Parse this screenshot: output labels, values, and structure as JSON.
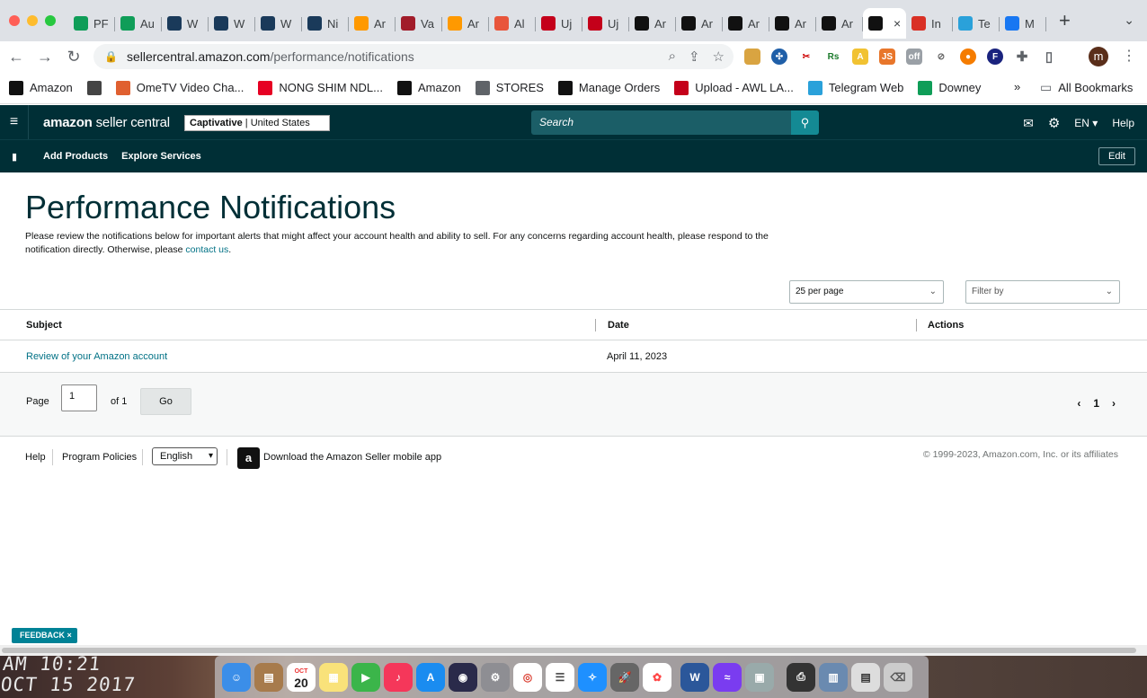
{
  "browser": {
    "tabs": [
      {
        "favicon": "sheets-icon",
        "label": "PF",
        "color": "#0f9d58"
      },
      {
        "favicon": "sheets-icon",
        "label": "Au",
        "color": "#0f9d58"
      },
      {
        "favicon": "box-icon",
        "label": "W",
        "color": "#1a3a5a"
      },
      {
        "favicon": "box-icon",
        "label": "W",
        "color": "#1a3a5a"
      },
      {
        "favicon": "box-icon",
        "label": "W",
        "color": "#1a3a5a"
      },
      {
        "favicon": "box-icon",
        "label": "Ni",
        "color": "#1a3a5a"
      },
      {
        "favicon": "amazon-icon",
        "label": "Ar",
        "color": "#ff9900"
      },
      {
        "favicon": "wv-icon",
        "label": "Va",
        "color": "#a11c2a"
      },
      {
        "favicon": "amazon-icon",
        "label": "Ar",
        "color": "#ff9900"
      },
      {
        "favicon": "pencil-icon",
        "label": "Al",
        "color": "#e8553b"
      },
      {
        "favicon": "upload-icon",
        "label": "Uj",
        "color": "#c4001a"
      },
      {
        "favicon": "upload-icon",
        "label": "Uj",
        "color": "#c4001a"
      },
      {
        "favicon": "amazon-a-icon",
        "label": "Ar",
        "color": "#111111"
      },
      {
        "favicon": "amazon-a-icon",
        "label": "Ar",
        "color": "#111111"
      },
      {
        "favicon": "amazon-a-icon",
        "label": "Ar",
        "color": "#111111"
      },
      {
        "favicon": "amazon-a-icon",
        "label": "Ar",
        "color": "#111111"
      },
      {
        "favicon": "amazon-a-icon",
        "label": "Ar",
        "color": "#111111"
      },
      {
        "favicon": "amazon-a-icon",
        "label": "",
        "color": "#111111",
        "active": true
      },
      {
        "favicon": "gmail-icon",
        "label": "In",
        "color": "#d93025"
      },
      {
        "favicon": "telegram-icon",
        "label": "Te",
        "color": "#2aa1da"
      },
      {
        "favicon": "facebook-icon",
        "label": "M",
        "color": "#1877f2"
      }
    ],
    "url_host": "sellercentral.amazon.com",
    "url_path": "/performance/notifications",
    "bookmarks": [
      {
        "icon": "amazon-a-icon",
        "label": "Amazon",
        "color": "#111111"
      },
      {
        "icon": "globe-icon",
        "label": "",
        "color": "#444444"
      },
      {
        "icon": "tv-icon",
        "label": "OmeTV Video Cha...",
        "color": "#e06030"
      },
      {
        "icon": "pinterest-icon",
        "label": "NONG SHIM NDL...",
        "color": "#e60023"
      },
      {
        "icon": "amazon-a-icon",
        "label": "Amazon",
        "color": "#111111"
      },
      {
        "icon": "folder-icon",
        "label": "STORES",
        "color": "#5f6368"
      },
      {
        "icon": "amazon-a-icon",
        "label": "Manage Orders",
        "color": "#111111"
      },
      {
        "icon": "upload-icon",
        "label": "Upload - AWL LA...",
        "color": "#c4001a"
      },
      {
        "icon": "telegram-icon",
        "label": "Telegram Web",
        "color": "#2aa1da"
      },
      {
        "icon": "sheets-icon",
        "label": "Downey",
        "color": "#0f9d58"
      }
    ],
    "bookmarks_more": "»",
    "all_bookmarks": "All Bookmarks",
    "profile_initial": "m"
  },
  "header": {
    "logo_bold": "amazon",
    "logo_rest": " seller central",
    "store_name": "Captivative",
    "store_region": "United States",
    "search_placeholder": "Search",
    "lang": "EN",
    "help": "Help"
  },
  "subnav": {
    "add_products": "Add Products",
    "explore_services": "Explore Services",
    "edit": "Edit"
  },
  "main": {
    "title": "Performance Notifications",
    "description": "Please review the notifications below for important alerts that might affect your account health and ability to sell. For any concerns regarding account health, please respond to the notification directly. Otherwise, please ",
    "contact_link": "contact us",
    "description_end": ".",
    "per_page": "25 per page",
    "filter_by": "Filter by",
    "columns": {
      "subject": "Subject",
      "date": "Date",
      "actions": "Actions"
    },
    "rows": [
      {
        "subject": "Review of your Amazon account",
        "date": "April 11, 2023",
        "actions": ""
      }
    ]
  },
  "pager": {
    "page_label": "Page",
    "page_value": "1",
    "of_label": "of 1",
    "go": "Go",
    "current": "1"
  },
  "footer": {
    "help": "Help",
    "program_policies": "Program Policies",
    "language": "English",
    "download_app": "Download the Amazon Seller mobile app",
    "copyright": "© 1999-2023, Amazon.com, Inc. or its affiliates"
  },
  "feedback": "FEEDBACK ×",
  "desktop": {
    "clock_line1": "AM 10:21",
    "clock_line2": "OCT 15 2017",
    "calendar_month": "OCT",
    "calendar_day": "20"
  },
  "colors": {
    "header_bg": "#002f36",
    "link": "#007185",
    "search_btn": "#148a94"
  }
}
